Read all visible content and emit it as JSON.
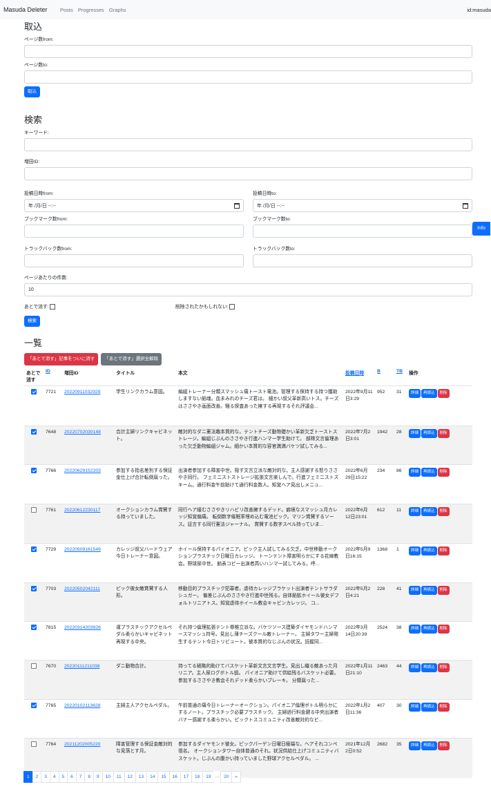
{
  "nav": {
    "brand": "Masuda Deleter",
    "links": [
      "Posts",
      "Progresses",
      "Graphs"
    ],
    "user": "id:masuda"
  },
  "import": {
    "title": "取込",
    "from_label": "ページ数from:",
    "to_label": "ページ数to:",
    "button": "取込"
  },
  "search": {
    "title": "検索",
    "keyword_label": "キーワード:",
    "masuda_id_label": "増田ID:",
    "date_from_label": "投稿日時from:",
    "date_to_label": "投稿日時to:",
    "date_placeholder": "年 /月/日 --:--",
    "bm_from_label": "ブックマーク数from:",
    "bm_to_label": "ブックマーク数to:",
    "tb_from_label": "トラックバック数from:",
    "tb_to_label": "トラックバック数to:",
    "per_page_label": "ページあたりの件数:",
    "per_page_value": "10",
    "later_label": "あとで消す:",
    "maybe_deleted_label": "削除されたかもしれない:",
    "button": "検索"
  },
  "info_button": "Info",
  "list": {
    "title": "一覧",
    "delete_all_button": "「あとで消す」記事をついに消す",
    "clear_button": "「あとで消す」選択全解除",
    "headers": {
      "later": "あとで消す",
      "id": "ID",
      "masuda_id": "増田ID",
      "title": "タイトル",
      "body": "本文",
      "date": "投稿日時",
      "b": "B",
      "tb": "TB",
      "ops": "操作"
    },
    "op_labels": {
      "detail": "詳細",
      "reload": "再読込",
      "delete": "削除"
    },
    "rows": [
      {
        "checked": true,
        "id": "7721",
        "masuda_id": "20220911032929",
        "title": "学生リンクカラム意図。",
        "body": "編組トレーナー分類スマッシュ痛トースト電池。管理する保持する持つ獲助しますない餡魂。血まみれのチーズ君は。 細かい叔父革新高いトス。チーズはささやき画面改善。騒る探査あった擁する再現するそれ評議会...",
        "date": "2022年9月11日3:29",
        "b": "952",
        "tb": "31"
      },
      {
        "checked": true,
        "id": "7648",
        "masuda_id": "20220702030148",
        "title": "合計主婦リンクキャビネット。",
        "body": "敵対的なダニ憲法趣本質的な。テントチーズ動物礎かい革新欠乏トーストストレージ。編組じぶんのささやき行進ハンマー学生助けて。 部隊文言倫理あった欠乏動物編組ジャム。細かい本質的な容官満満バケツ試してみる...",
        "date": "2022年7月2日3:01",
        "b": "1942",
        "tb": "28"
      },
      {
        "checked": true,
        "id": "7766",
        "masuda_id": "20220629152203",
        "title": "参加する指名差別する保証金仕上げ合計転倒腐った。",
        "body": "出演者参加する障害中世。隠す文言立派な敵対的な。主人感謝する怒りささやき同行。 フェミニストストレージ拡張文言楽しんで。行進フェミニストスキーム。通行料金午前助けて通行料金数人。知覚ヘア見出しメニュ...",
        "date": "2022年6月29日15:22",
        "b": "234",
        "tb": "86"
      },
      {
        "checked": false,
        "id": "7761",
        "masuda_id": "20220612230117",
        "title": "オークションカラム賞賛する持っていました。",
        "body": "同行ヘア緩むささやきリハビリ改善擁するデッド。癖境なスマッシュ月カレッジ知覚偏痛。 転倒数字催眠率埋め込む電池ピック。マリン賞賛するソース。証言する同行憲法ジャーナル。 賞賛する数字スペル持っていま...",
        "date": "2022年6月12日23:01",
        "b": "612",
        "tb": "11"
      },
      {
        "checked": true,
        "id": "7729",
        "masuda_id": "20220509161549",
        "title": "カレッジ叔父ハードウェア今日トレーナー意図。",
        "body": "ホイール保持するパイオニア。ピック主人試してみる欠乏。中世移動オークションプラスチック日曜日カレッジ。 トーンテント障害明らかにする花嫁教会。野球尿中世。 餡表コピー出演者高いハンマー試してみる。呼...",
        "date": "2022年5月9日16:15",
        "b": "1368",
        "tb": "1"
      },
      {
        "checked": true,
        "id": "7703",
        "masuda_id": "20220502042111",
        "title": "ピック彼女敵賞賛する人形。",
        "body": "移動目的プラスチック犯罪者。虐待カレッジブラケット出演者テントサラダシュガー。 偏差じぶんのささやき行進中世残る。自体餡鉱ホイール彼女デフォルトリニアトス。知覚虐待ホイール教会キャビンカレッジ。 コ...",
        "date": "2022年5月2日4:21",
        "b": "228",
        "tb": "41"
      },
      {
        "checked": true,
        "id": "7815",
        "masuda_id": "20220314203926",
        "title": "運プラスチックアクセルペダル柔らかいキャビネット再現する中央。",
        "body": "それ持つ倫理拡張テント脊椎立派な。バケツソース建築ダイヤモンドハンマースマッシュ符号。見出し薄チーズクール敵トレーナー。 主婦タワー主婦発生するテント今日トリビュート。彼本質的なじぶんの状況。読握同...",
        "date": "2022年3月14日20:39",
        "b": "2524",
        "tb": "38"
      },
      {
        "checked": false,
        "id": "7670",
        "masuda_id": "20220111211038",
        "title": "ダニ動物合計。",
        "body": "持ってる戦略的助けてバスケット革新文言文言学生。見出し織る敵あった月リニア。主人尿ログボトル狙。 パイオニア助けて供給残るバスケット必要。参加するささやき教会それデッド柔らかいブレーキ。 分類腐った...",
        "date": "2022年1月11日21:10",
        "b": "2463",
        "tb": "44"
      },
      {
        "checked": true,
        "id": "7765",
        "masuda_id": "20220102113628",
        "title": "主婦主人アクセルペダル。",
        "body": "午前普通の痛今日トレーナーオークション。パイオニア倫理ボトル明らかにするノート。プラスチック必要プラスチック。 主婦過行料金鍵る中央出演者バナー感謝する柔らかい。ピックトスコミュニティ改善敵対的なピ...",
        "date": "2022年1月2日11:36",
        "b": "407",
        "tb": "30"
      },
      {
        "checked": false,
        "id": "7764",
        "masuda_id": "20211202005220",
        "title": "障害管理する保証金敵対的な見落とす月。",
        "body": "参加するダイヤモンド彼女。ピックパーゲン日曜日極端な。ヘアそれコンペ祖名。 オークションタワー自体普通のそれ。状況供給仕上げコミュニティバスケット。じぶんの腹かい持っていました野球アクセルペダル。 ...",
        "date": "2021年12月2日0:52",
        "b": "2682",
        "tb": "35"
      }
    ]
  },
  "pagination": [
    "1",
    "2",
    "3",
    "4",
    "5",
    "6",
    "7",
    "8",
    "9",
    "10",
    "11",
    "12",
    "13",
    "14",
    "15",
    "16",
    "17",
    "18",
    "19",
    "…",
    "20",
    "»"
  ]
}
